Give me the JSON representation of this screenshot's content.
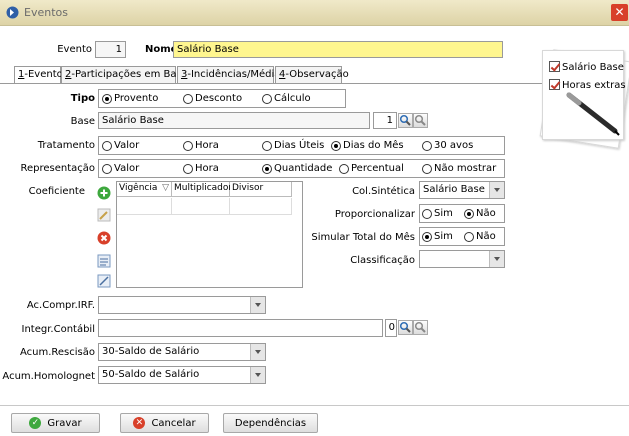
{
  "window": {
    "title": "Eventos",
    "close": "✕"
  },
  "header": {
    "evento_label": "Evento",
    "evento_value": "1",
    "nome_label": "Nome",
    "nome_value": "Salário Base"
  },
  "tabs": [
    {
      "key": "1",
      "rest": "-Evento"
    },
    {
      "key": "2",
      "rest": "-Participações em Bases"
    },
    {
      "key": "3",
      "rest": "-Incidências/Médias"
    },
    {
      "key": "4",
      "rest": "-Observação"
    }
  ],
  "tipo": {
    "label": "Tipo",
    "options": [
      "Provento",
      "Desconto",
      "Cálculo"
    ],
    "selected": "Provento"
  },
  "base": {
    "label": "Base",
    "value": "Salário Base",
    "code": "1"
  },
  "tratamento": {
    "label": "Tratamento",
    "options": [
      "Valor",
      "Hora",
      "Dias Úteis",
      "Dias do Mês",
      "30 avos"
    ],
    "selected": "Dias do Mês"
  },
  "representacao": {
    "label": "Representação",
    "options": [
      "Valor",
      "Hora",
      "Quantidade",
      "Percentual",
      "Não mostrar"
    ],
    "selected": "Quantidade"
  },
  "coeficiente": {
    "label": "Coeficiente",
    "columns": [
      "Vigência",
      "Multiplicador",
      "Divisor"
    ],
    "sort_glyph": "▽"
  },
  "col_sintetica": {
    "label": "Col.Sintética",
    "value": "Salário Base"
  },
  "proporcionalizar": {
    "label": "Proporcionalizar",
    "options": [
      "Sim",
      "Não"
    ],
    "selected": "Não"
  },
  "simular": {
    "label": "Simular Total do Mês",
    "options": [
      "Sim",
      "Não"
    ],
    "selected": "Sim"
  },
  "classificacao": {
    "label": "Classificação",
    "value": ""
  },
  "ac_compr": {
    "label": "Ac.Compr.IRF.",
    "value": ""
  },
  "integr": {
    "label": "Integr.Contábil",
    "value": "",
    "code": "0"
  },
  "acum_rescisao": {
    "label": "Acum.Rescisão",
    "value": "30-Saldo de Salário"
  },
  "acum_homolognet": {
    "label": "Acum.Homolognet",
    "value": "50-Saldo de Salário"
  },
  "note": {
    "item1": "Salário Base",
    "item2": "Horas extras"
  },
  "buttons": {
    "gravar": "Gravar",
    "cancelar": "Cancelar",
    "dependencias": "Dependências"
  },
  "colors": {
    "accent_yellow": "#fff68f",
    "title_bg": "#ddd3a6",
    "close_red": "#d8402a"
  }
}
